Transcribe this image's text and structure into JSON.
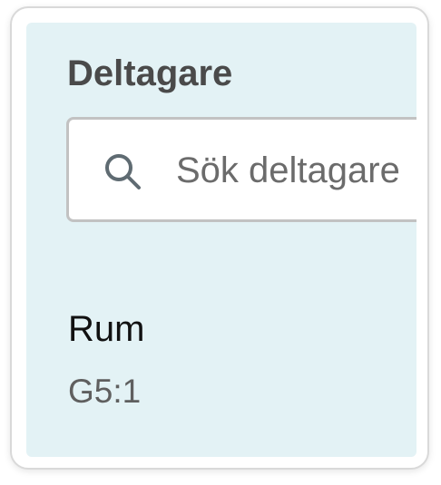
{
  "participants": {
    "title": "Deltagare",
    "search": {
      "placeholder": "Sök deltagare",
      "value": "",
      "icon": "search-icon"
    }
  },
  "room": {
    "label": "Rum",
    "value": "G5:1"
  },
  "colors": {
    "panel_background": "#e3f2f5",
    "card_border": "#d9d9d9",
    "title_text": "#4a4a4a",
    "input_border": "#c2c2c2"
  }
}
